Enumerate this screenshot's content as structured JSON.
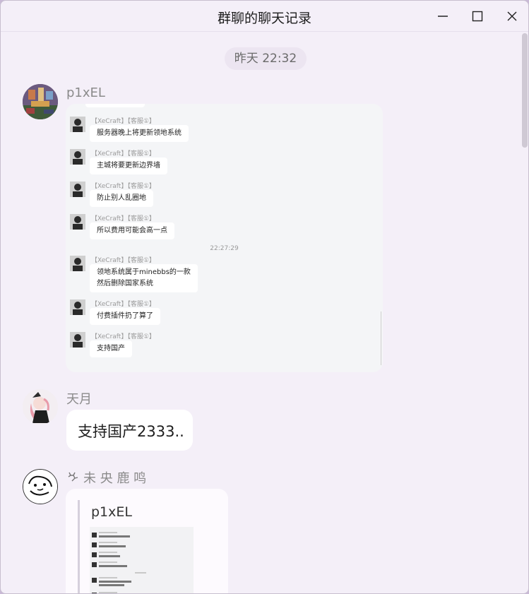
{
  "window": {
    "title": "群聊的聊天记录",
    "buttons": [
      "minimize",
      "maximize",
      "close"
    ]
  },
  "date_badge": "昨天 22:32",
  "messages": [
    {
      "sender": "p1xEL",
      "avatar": "avatar-pixel-art",
      "forwarded": {
        "items": [
          {
            "name": "【XeCraft】【客服①】",
            "text": "服务器晚上将更新领地系统"
          },
          {
            "name": "【XeCraft】【客服①】",
            "text": "主城将要更新边界墙"
          },
          {
            "name": "【XeCraft】【客服①】",
            "text": "防止别人乱圈地"
          },
          {
            "name": "【XeCraft】【客服①】",
            "text": "所以费用可能会高一点"
          },
          {
            "name": "【XeCraft】【客服①】",
            "text": "领地系统属于minebbs的一款",
            "text2": "然后删除国家系统"
          },
          {
            "name": "【XeCraft】【客服①】",
            "text": "付费插件扔了算了"
          },
          {
            "name": "【XeCraft】【客服①】",
            "text": "支持国产"
          }
        ],
        "time_divider": "22:27:29"
      }
    },
    {
      "sender": "天月",
      "avatar": "avatar-anime-girl",
      "text": "支持国产2333.."
    },
    {
      "sender_icon": "deer-icon",
      "sender": "未 央 鹿 鸣",
      "avatar": "avatar-sketch",
      "quote": {
        "name": "p1xEL",
        "preview": "thumbnail-of-forwarded-chat"
      }
    }
  ],
  "colors": {
    "window_bg": "#f4eff8",
    "bubble_bg": "#ffffff",
    "card_bg": "#f4f5f7",
    "muted_text": "#8b8b8b"
  }
}
